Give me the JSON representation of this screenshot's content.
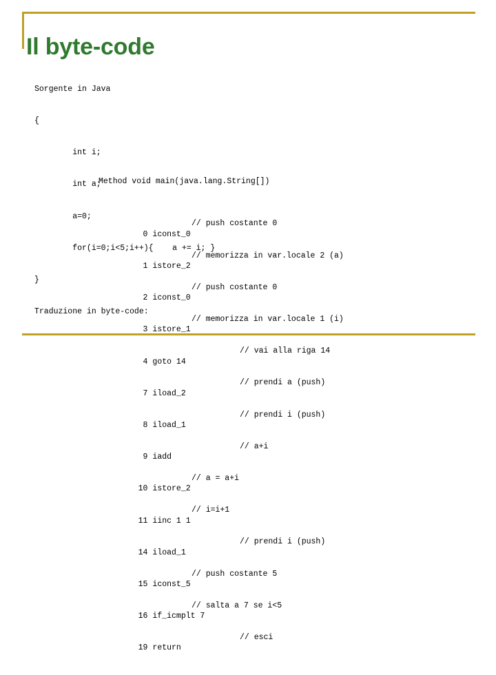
{
  "slide": {
    "title": "Il byte-code",
    "accent_color": "#bfa022",
    "title_color": "#2f7a2f",
    "background_color": "#ffffff"
  },
  "source": {
    "heading": "Sorgente in Java",
    "lines": [
      "{",
      "        int i;",
      "        int a;",
      "        a=0;",
      "        for(i=0;i<5;i++){    a += i; }",
      "}"
    ],
    "footer": "Traduzione in byte-code:"
  },
  "bytecode": {
    "method_signature": "Method void main(java.lang.String[])",
    "instructions": [
      {
        "offset": "0",
        "opcode": "iconst_0",
        "comment": "// push costante 0",
        "comment_column": "near"
      },
      {
        "offset": "1",
        "opcode": "istore_2",
        "comment": "// memorizza in var.locale 2 (a)",
        "comment_column": "near"
      },
      {
        "offset": "2",
        "opcode": "iconst_0",
        "comment": "// push costante 0",
        "comment_column": "near"
      },
      {
        "offset": "3",
        "opcode": "istore_1",
        "comment": "// memorizza in var.locale 1 (i)",
        "comment_column": "near"
      },
      {
        "offset": "4",
        "opcode": "goto 14",
        "comment": "// vai alla riga 14",
        "comment_column": "far"
      },
      {
        "offset": "7",
        "opcode": "iload_2",
        "comment": "// prendi a (push)",
        "comment_column": "far"
      },
      {
        "offset": "8",
        "opcode": "iload_1",
        "comment": "// prendi i (push)",
        "comment_column": "far"
      },
      {
        "offset": "9",
        "opcode": "iadd",
        "comment": "// a+i",
        "comment_column": "far"
      },
      {
        "offset": "10",
        "opcode": "istore_2",
        "comment": "// a = a+i",
        "comment_column": "near"
      },
      {
        "offset": "11",
        "opcode": "iinc 1 1",
        "comment": "// i=i+1",
        "comment_column": "near"
      },
      {
        "offset": "14",
        "opcode": "iload_1",
        "comment": "// prendi i (push)",
        "comment_column": "far"
      },
      {
        "offset": "15",
        "opcode": "iconst_5",
        "comment": "// push costante 5",
        "comment_column": "near"
      },
      {
        "offset": "16",
        "opcode": "if_icmplt 7",
        "comment": "// salta a 7 se i<5",
        "comment_column": "near"
      },
      {
        "offset": "19",
        "opcode": "return",
        "comment": "// esci",
        "comment_column": "far"
      }
    ]
  }
}
